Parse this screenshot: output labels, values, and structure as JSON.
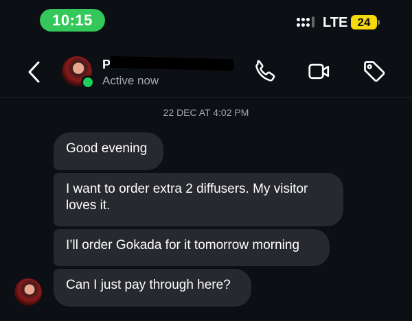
{
  "status_bar": {
    "time": "10:15",
    "network": "LTE",
    "battery": "24"
  },
  "header": {
    "contact_name_visible": "P",
    "presence": "Active now",
    "icons": [
      "back-chevron-icon",
      "phone-icon",
      "video-icon",
      "tag-icon"
    ],
    "colors": {
      "online": "#1bd15a",
      "time_pill": "#34c759",
      "battery": "#f5d90a"
    }
  },
  "conversation": {
    "timestamp": "22 DEC AT 4:02 PM",
    "messages": [
      {
        "text": "Good evening"
      },
      {
        "text": "I want to order extra 2 diffusers. My visitor loves it."
      },
      {
        "text": "I’ll order Gokada for it tomorrow morning"
      },
      {
        "text": "Can I just pay through here?"
      }
    ]
  }
}
